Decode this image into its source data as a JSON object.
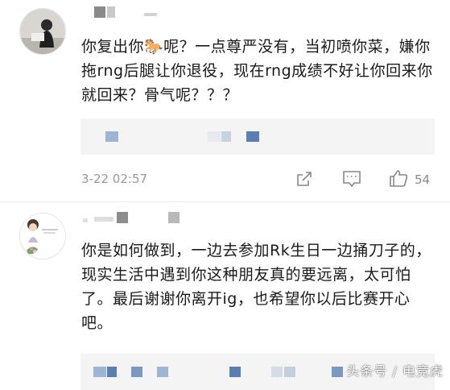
{
  "comments": [
    {
      "text": "你复出你🐎呢？一点尊严没有，当初喷你菜，嫌你拖rng后腿让你退役，现在rng成绩不好让你回来你就回来？骨气呢？？？",
      "timestamp": "3-22 02:57",
      "likes": "54"
    },
    {
      "text": "你是如何做到，一边去参加Rk生日一边捅刀子的，现实生活中遇到你这种朋友真的要远离，太可怕了。最后谢谢你离开ig，也希望你以后比赛开心吧。"
    }
  ],
  "watermark": "头条号 / 电竞虎",
  "icons": {
    "share": "share-icon",
    "reply": "comment-icon",
    "like": "thumbs-up-icon"
  },
  "colors": {
    "meta_text": "#999999",
    "quote_bg": "#f4f4f4",
    "mosaic_blue": "#5a7fb0"
  }
}
